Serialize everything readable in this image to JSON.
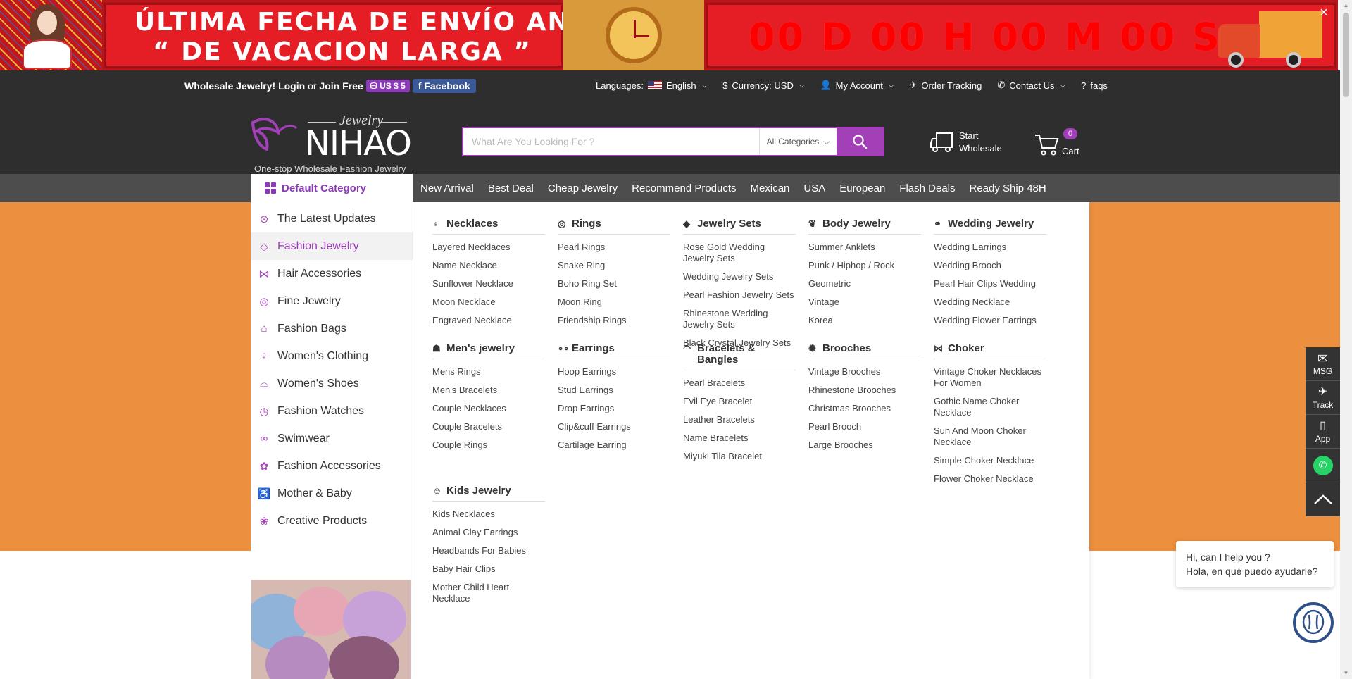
{
  "banner": {
    "title_line1": "ÚLTIMA FECHA DE ENVÍO ANTES",
    "title_line2": "“ DE VACACION LARGA ”",
    "countdown": "00 D 00 H 00 M 00 S",
    "close": "×"
  },
  "topbar": {
    "wholesale": "Wholesale Jewelry!",
    "login": "Login",
    "or": "or",
    "join": "Join Free",
    "coupon": "US $ 5",
    "facebook": "Facebook",
    "languages_label": "Languages:",
    "language": "English",
    "currency": "Currency: USD",
    "my_account": "My Account",
    "order_tracking": "Order Tracking",
    "contact_us": "Contact Us",
    "faqs": "faqs"
  },
  "header": {
    "logo_jewelry": "Jewelry",
    "logo_name": "NIHAO",
    "tagline": "One-stop Wholesale Fashion Jewelry",
    "search_placeholder": "What Are You Looking For ?",
    "category_select": "All Categories",
    "start": "Start",
    "wholesale": "Wholesale",
    "cart_label": "Cart",
    "cart_count": "0",
    "accent_color": "#a340b8"
  },
  "nav": {
    "default_category": "Default Category",
    "links": [
      "New Arrival",
      "Best Deal",
      "Cheap Jewelry",
      "Recommend Products",
      "Mexican",
      "USA",
      "European",
      "Flash Deals",
      "Ready Ship 48H"
    ]
  },
  "sidebar": {
    "items": [
      {
        "label": "The Latest Updates",
        "icon": "arrow-up-circle-icon"
      },
      {
        "label": "Fashion Jewelry",
        "icon": "diamond-icon",
        "active": true
      },
      {
        "label": "Hair Accessories",
        "icon": "bow-icon"
      },
      {
        "label": "Fine Jewelry",
        "icon": "ring-icon"
      },
      {
        "label": "Fashion Bags",
        "icon": "bag-icon"
      },
      {
        "label": "Women's Clothing",
        "icon": "dress-icon"
      },
      {
        "label": "Women's Shoes",
        "icon": "shoe-icon"
      },
      {
        "label": "Fashion Watches",
        "icon": "watch-icon"
      },
      {
        "label": "Swimwear",
        "icon": "swimwear-icon"
      },
      {
        "label": "Fashion Accessories",
        "icon": "accessory-icon"
      },
      {
        "label": "Mother & Baby",
        "icon": "stroller-icon"
      },
      {
        "label": "Creative Products",
        "icon": "gift-icon"
      }
    ]
  },
  "mega": {
    "columns": [
      {
        "title": "Necklaces",
        "icon": "necklace-icon",
        "links": [
          "Layered Necklaces",
          "Name Necklace",
          "Sunflower Necklace",
          "Moon Necklace",
          "Engraved Necklace"
        ]
      },
      {
        "title": "Rings",
        "icon": "ring-icon",
        "links": [
          "Pearl Rings",
          "Snake Ring",
          "Boho Ring Set",
          "Moon Ring",
          "Friendship Rings"
        ]
      },
      {
        "title": "Jewelry Sets",
        "icon": "gem-icon",
        "links": [
          "Rose Gold Wedding Jewelry Sets",
          "Wedding Jewelry Sets",
          "Pearl Fashion Jewelry Sets",
          "Rhinestone Wedding Jewelry Sets",
          "Black Crystal Jewelry Sets"
        ]
      },
      {
        "title": "Body Jewelry",
        "icon": "body-jewelry-icon",
        "links": [
          "Summer Anklets",
          "Punk / Hiphop / Rock",
          "Geometric",
          "Vintage",
          "Korea"
        ]
      },
      {
        "title": "Wedding Jewelry",
        "icon": "wedding-icon",
        "links": [
          "Wedding Earrings",
          "Wedding Brooch",
          "Pearl Hair Clips Wedding",
          "Wedding Necklace",
          "Wedding Flower Earrings"
        ]
      },
      {
        "title": "Men's jewelry",
        "icon": "man-icon",
        "links": [
          "Mens Rings",
          "Men's Bracelets",
          "Couple Necklaces",
          "Couple Bracelets",
          "Couple Rings"
        ]
      },
      {
        "title": "Earrings",
        "icon": "earrings-icon",
        "links": [
          "Hoop Earrings",
          "Stud Earrings",
          "Drop Earrings",
          "Clip&cuff Earrings",
          "Cartilage Earring"
        ]
      },
      {
        "title": "Bracelets & Bangles",
        "icon": "bracelet-icon",
        "links": [
          "Pearl Bracelets",
          "Evil Eye Bracelet",
          "Leather Bracelets",
          "Name Bracelets",
          "Miyuki Tila Bracelet"
        ]
      },
      {
        "title": "Brooches",
        "icon": "brooch-icon",
        "links": [
          "Vintage Brooches",
          "Rhinestone Brooches",
          "Christmas Brooches",
          "Pearl Brooch",
          "Large Brooches"
        ]
      },
      {
        "title": "Choker",
        "icon": "choker-icon",
        "links": [
          "Vintage Choker Necklaces For Women",
          "Gothic Name Choker Necklace",
          "Sun And Moon Choker Necklace",
          "Simple Choker Necklace",
          "Flower Choker Necklace"
        ]
      },
      {
        "title": "Kids Jewelry",
        "icon": "kids-icon",
        "links": [
          "Kids Necklaces",
          "Animal Clay Earrings",
          "Headbands For Babies",
          "Baby Hair Clips",
          "Mother Child Heart Necklace"
        ]
      }
    ]
  },
  "float": {
    "msg": "MSG",
    "track": "Track",
    "app": "App"
  },
  "chat": {
    "line1": "Hi, can I help you ?",
    "line2": "Hola, en qué puedo ayudarle?"
  }
}
